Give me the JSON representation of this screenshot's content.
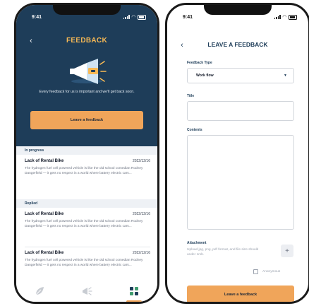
{
  "status": {
    "time": "9:41"
  },
  "feedback_screen": {
    "title": "FEEDBACK",
    "back_icon": "chevron-left-icon",
    "illustration": "megaphone-icon",
    "intro_text": "Every feedback for us is important and we'll get back soon.",
    "cta_label": "Leave a feedback",
    "sections": [
      {
        "label": "In progress",
        "items": [
          {
            "title": "Lack of Rental Bike",
            "date": "2022/12/16",
            "body": "The hydrogen fuel cell powered vehicle is like the old school comedian Rodney Dangerfield — it gets no respect in a world where battery electric cars..."
          }
        ]
      },
      {
        "label": "Replied",
        "items": [
          {
            "title": "Lack of Rental Bike",
            "date": "2022/12/16",
            "body": "The hydrogen fuel cell powered vehicle is like the old school comedian Rodney Dangerfield — it gets no respect in a world where battery electric cars..."
          },
          {
            "title": "Lack of Rental Bike",
            "date": "2022/12/16",
            "body": "The hydrogen fuel cell powered vehicle is like the old school comedian Rodney Dangerfield — it gets no respect in a world where battery electric cars..."
          }
        ]
      }
    ],
    "nav_icons": [
      "leaf-icon",
      "megaphone-icon",
      "grid-icon"
    ],
    "active_nav_index": 2
  },
  "form_screen": {
    "title": "LEAVE A FEEDBACK",
    "back_icon": "chevron-left-icon",
    "type_label": "Feedback Type",
    "type_value": "Work flow",
    "title_label": "Title",
    "title_value": "",
    "contents_label": "Contents",
    "contents_value": "",
    "attachment_label": "Attachment",
    "attachment_hint": "Upload jpg, png, pdf format, and file size should under 1mb.",
    "plus_label": "+",
    "anonymous_label": "Anonymous",
    "submit_label": "Leave a feedback"
  },
  "colors": {
    "navy": "#1e3d59",
    "accent_orange": "#f0a55a",
    "title_yellow": "#f7b955"
  }
}
